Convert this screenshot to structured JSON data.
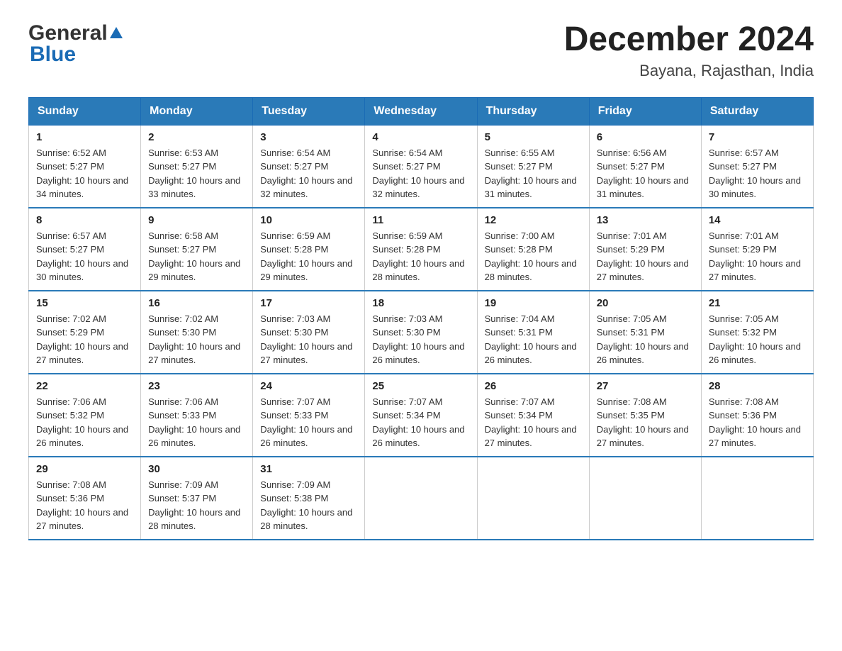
{
  "header": {
    "logo": {
      "line1": "General",
      "line2": "Blue"
    },
    "month_year": "December 2024",
    "location": "Bayana, Rajasthan, India"
  },
  "days_of_week": [
    "Sunday",
    "Monday",
    "Tuesday",
    "Wednesday",
    "Thursday",
    "Friday",
    "Saturday"
  ],
  "weeks": [
    [
      {
        "day": "1",
        "sunrise": "6:52 AM",
        "sunset": "5:27 PM",
        "daylight": "10 hours and 34 minutes."
      },
      {
        "day": "2",
        "sunrise": "6:53 AM",
        "sunset": "5:27 PM",
        "daylight": "10 hours and 33 minutes."
      },
      {
        "day": "3",
        "sunrise": "6:54 AM",
        "sunset": "5:27 PM",
        "daylight": "10 hours and 32 minutes."
      },
      {
        "day": "4",
        "sunrise": "6:54 AM",
        "sunset": "5:27 PM",
        "daylight": "10 hours and 32 minutes."
      },
      {
        "day": "5",
        "sunrise": "6:55 AM",
        "sunset": "5:27 PM",
        "daylight": "10 hours and 31 minutes."
      },
      {
        "day": "6",
        "sunrise": "6:56 AM",
        "sunset": "5:27 PM",
        "daylight": "10 hours and 31 minutes."
      },
      {
        "day": "7",
        "sunrise": "6:57 AM",
        "sunset": "5:27 PM",
        "daylight": "10 hours and 30 minutes."
      }
    ],
    [
      {
        "day": "8",
        "sunrise": "6:57 AM",
        "sunset": "5:27 PM",
        "daylight": "10 hours and 30 minutes."
      },
      {
        "day": "9",
        "sunrise": "6:58 AM",
        "sunset": "5:27 PM",
        "daylight": "10 hours and 29 minutes."
      },
      {
        "day": "10",
        "sunrise": "6:59 AM",
        "sunset": "5:28 PM",
        "daylight": "10 hours and 29 minutes."
      },
      {
        "day": "11",
        "sunrise": "6:59 AM",
        "sunset": "5:28 PM",
        "daylight": "10 hours and 28 minutes."
      },
      {
        "day": "12",
        "sunrise": "7:00 AM",
        "sunset": "5:28 PM",
        "daylight": "10 hours and 28 minutes."
      },
      {
        "day": "13",
        "sunrise": "7:01 AM",
        "sunset": "5:29 PM",
        "daylight": "10 hours and 27 minutes."
      },
      {
        "day": "14",
        "sunrise": "7:01 AM",
        "sunset": "5:29 PM",
        "daylight": "10 hours and 27 minutes."
      }
    ],
    [
      {
        "day": "15",
        "sunrise": "7:02 AM",
        "sunset": "5:29 PM",
        "daylight": "10 hours and 27 minutes."
      },
      {
        "day": "16",
        "sunrise": "7:02 AM",
        "sunset": "5:30 PM",
        "daylight": "10 hours and 27 minutes."
      },
      {
        "day": "17",
        "sunrise": "7:03 AM",
        "sunset": "5:30 PM",
        "daylight": "10 hours and 27 minutes."
      },
      {
        "day": "18",
        "sunrise": "7:03 AM",
        "sunset": "5:30 PM",
        "daylight": "10 hours and 26 minutes."
      },
      {
        "day": "19",
        "sunrise": "7:04 AM",
        "sunset": "5:31 PM",
        "daylight": "10 hours and 26 minutes."
      },
      {
        "day": "20",
        "sunrise": "7:05 AM",
        "sunset": "5:31 PM",
        "daylight": "10 hours and 26 minutes."
      },
      {
        "day": "21",
        "sunrise": "7:05 AM",
        "sunset": "5:32 PM",
        "daylight": "10 hours and 26 minutes."
      }
    ],
    [
      {
        "day": "22",
        "sunrise": "7:06 AM",
        "sunset": "5:32 PM",
        "daylight": "10 hours and 26 minutes."
      },
      {
        "day": "23",
        "sunrise": "7:06 AM",
        "sunset": "5:33 PM",
        "daylight": "10 hours and 26 minutes."
      },
      {
        "day": "24",
        "sunrise": "7:07 AM",
        "sunset": "5:33 PM",
        "daylight": "10 hours and 26 minutes."
      },
      {
        "day": "25",
        "sunrise": "7:07 AM",
        "sunset": "5:34 PM",
        "daylight": "10 hours and 26 minutes."
      },
      {
        "day": "26",
        "sunrise": "7:07 AM",
        "sunset": "5:34 PM",
        "daylight": "10 hours and 27 minutes."
      },
      {
        "day": "27",
        "sunrise": "7:08 AM",
        "sunset": "5:35 PM",
        "daylight": "10 hours and 27 minutes."
      },
      {
        "day": "28",
        "sunrise": "7:08 AM",
        "sunset": "5:36 PM",
        "daylight": "10 hours and 27 minutes."
      }
    ],
    [
      {
        "day": "29",
        "sunrise": "7:08 AM",
        "sunset": "5:36 PM",
        "daylight": "10 hours and 27 minutes."
      },
      {
        "day": "30",
        "sunrise": "7:09 AM",
        "sunset": "5:37 PM",
        "daylight": "10 hours and 28 minutes."
      },
      {
        "day": "31",
        "sunrise": "7:09 AM",
        "sunset": "5:38 PM",
        "daylight": "10 hours and 28 minutes."
      },
      null,
      null,
      null,
      null
    ]
  ],
  "labels": {
    "sunrise": "Sunrise:",
    "sunset": "Sunset:",
    "daylight": "Daylight:"
  }
}
